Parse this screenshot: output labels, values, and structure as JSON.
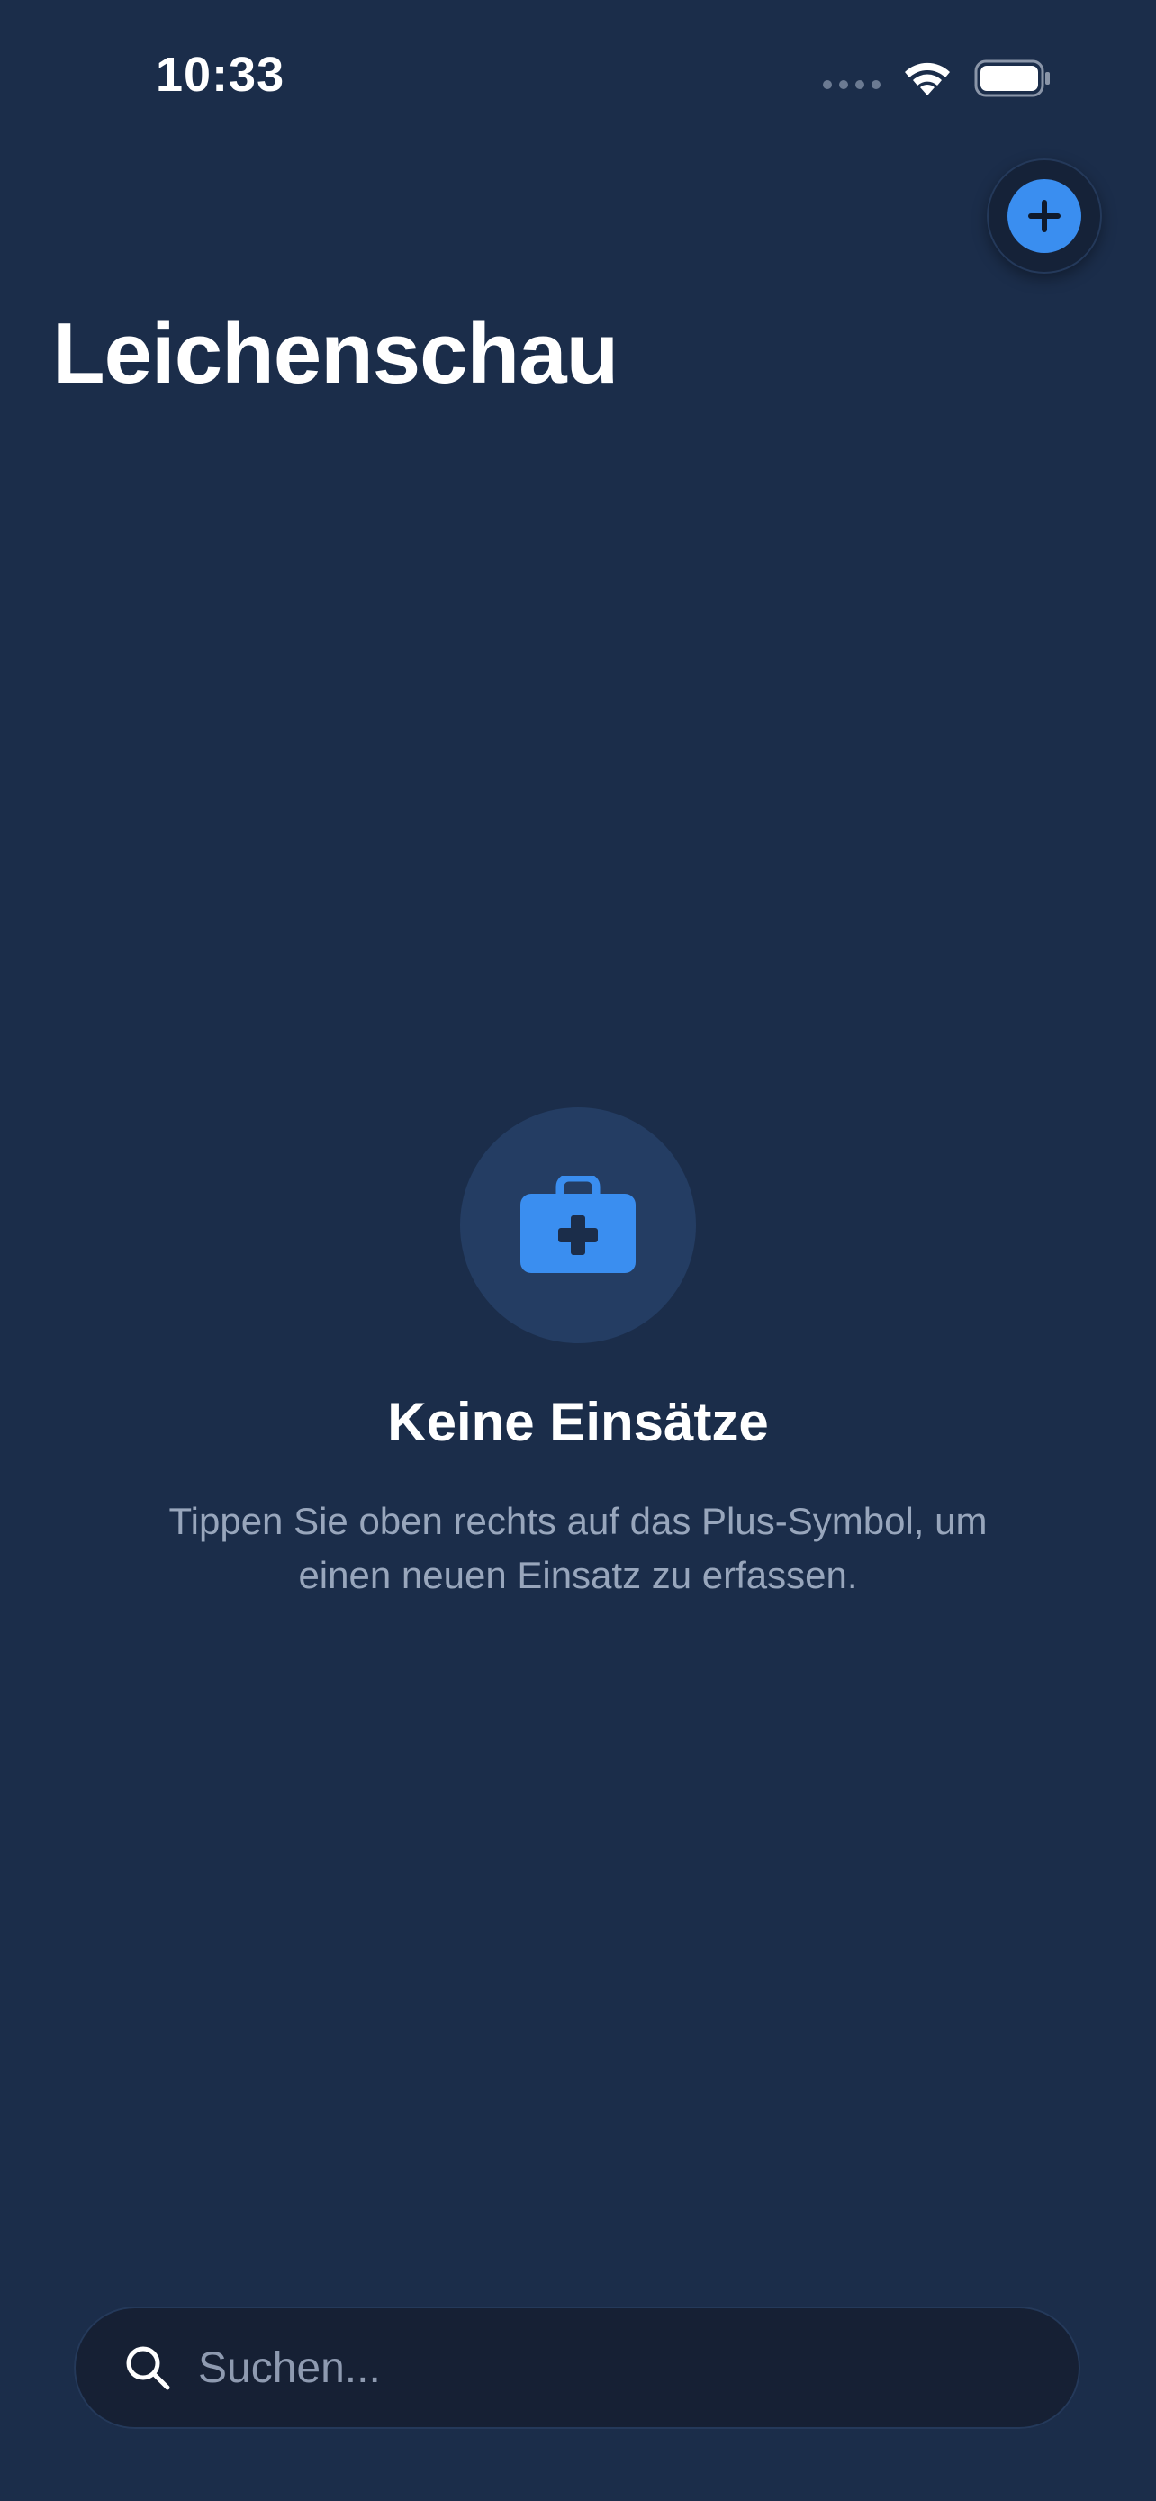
{
  "status_bar": {
    "time": "10:33",
    "icons": [
      "cellular-signal-icon",
      "wifi-icon",
      "battery-icon"
    ]
  },
  "header": {
    "title": "Leichenschau",
    "add_button_icon": "plus-icon"
  },
  "empty_state": {
    "icon": "medical-kit-icon",
    "title": "Keine Einsätze",
    "message": "Tippen Sie oben rechts auf das Plus-Symbol, um einen neuen Einsatz zu erfassen."
  },
  "search": {
    "placeholder": "Suchen...",
    "value": "",
    "icon": "search-icon"
  },
  "colors": {
    "background": "#1b2d4a",
    "accent": "#3a8ef0",
    "icon_circle": "#243d63",
    "search_background": "#162034",
    "secondary_text": "#98a6bc"
  }
}
